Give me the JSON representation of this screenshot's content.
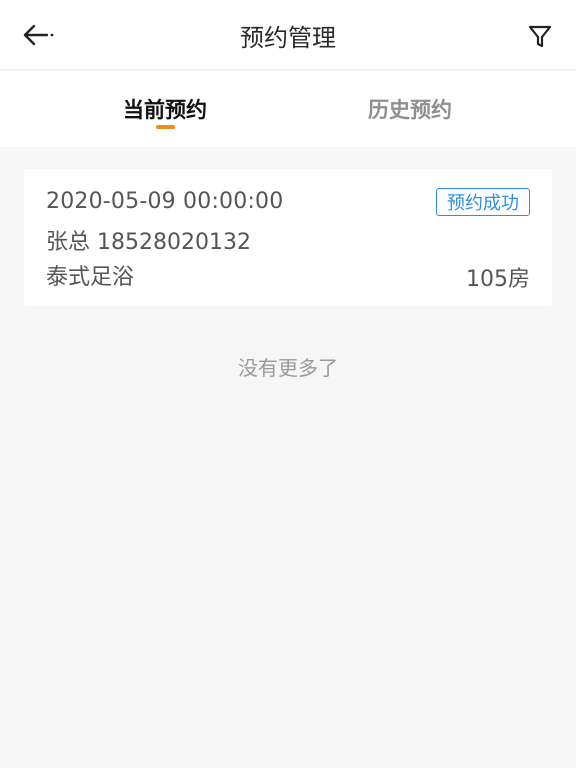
{
  "header": {
    "title": "预约管理",
    "back_icon": "arrow-left-icon",
    "filter_icon": "filter-icon"
  },
  "tabs": [
    {
      "label": "当前预约",
      "active": true
    },
    {
      "label": "历史预约",
      "active": false
    }
  ],
  "colors": {
    "accent": "#f08c1a",
    "status_blue": "#2f8fe6",
    "background": "#f6f6f6"
  },
  "reservations": [
    {
      "datetime": "2020-05-09 00:00:00",
      "contact": "张总 18528020132",
      "service": "泰式足浴",
      "room": "105房",
      "status": "预约成功"
    }
  ],
  "footer_text": "没有更多了"
}
